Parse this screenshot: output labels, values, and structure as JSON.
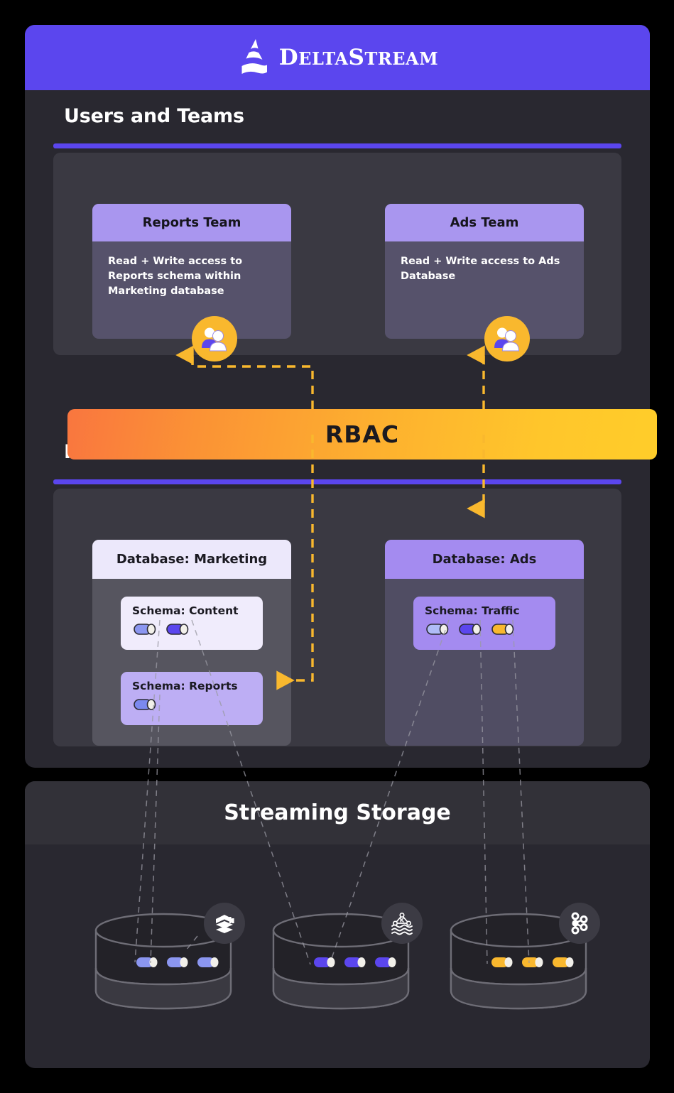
{
  "brand": {
    "name_main": "D",
    "name_full": "DeltaStream",
    "logo_icon": "deltastream-logo-icon"
  },
  "sections": {
    "users_and_teams": {
      "title": "Users and Teams",
      "teams": [
        {
          "name": "Reports Team",
          "access": "Read + Write access to Reports schema within Marketing database",
          "icon": "people-icon"
        },
        {
          "name": "Ads Team",
          "access": "Read + Write access to Ads Database",
          "icon": "people-icon"
        }
      ]
    },
    "rbac": {
      "label": "RBAC"
    },
    "federated_data": {
      "title": "Federated Data",
      "databases": [
        {
          "name": "Database: Marketing",
          "header_color": "#ece8fb",
          "body_color": "#56555f",
          "schemas": [
            {
              "name": "Schema: Content",
              "box_color": "#f0ecfc",
              "streams": [
                "#8b96f0",
                "#5b46ee"
              ]
            },
            {
              "name": "Schema: Reports",
              "box_color": "#bdaef4",
              "streams": [
                "#7b89ee"
              ]
            }
          ]
        },
        {
          "name": "Database: Ads",
          "header_color": "#a48bf0",
          "body_color": "#504d63",
          "schemas": [
            {
              "name": "Schema: Traffic",
              "box_color": "#a48bf0",
              "streams": [
                "#afbcf7",
                "#5b46ee",
                "#f9b82e"
              ]
            }
          ]
        }
      ]
    },
    "streaming_storage": {
      "title": "Streaming Storage",
      "drums": [
        {
          "badge_icon": "databricks-icon",
          "streams": [
            "#8b96f0",
            "#8b96f0",
            "#8b96f0"
          ]
        },
        {
          "badge_icon": "kafka-waves-icon",
          "streams": [
            "#5b46ee",
            "#5b46ee",
            "#5b46ee"
          ]
        },
        {
          "badge_icon": "kafka-nodes-icon",
          "streams": [
            "#f9b82e",
            "#f9b82e",
            "#f9b82e"
          ]
        }
      ]
    }
  },
  "colors": {
    "brand_purple": "#5b46ee",
    "accent_amber": "#f9b82e",
    "panel_dark": "#292830",
    "inner_panel": "#3a3942",
    "background": "#000000"
  }
}
